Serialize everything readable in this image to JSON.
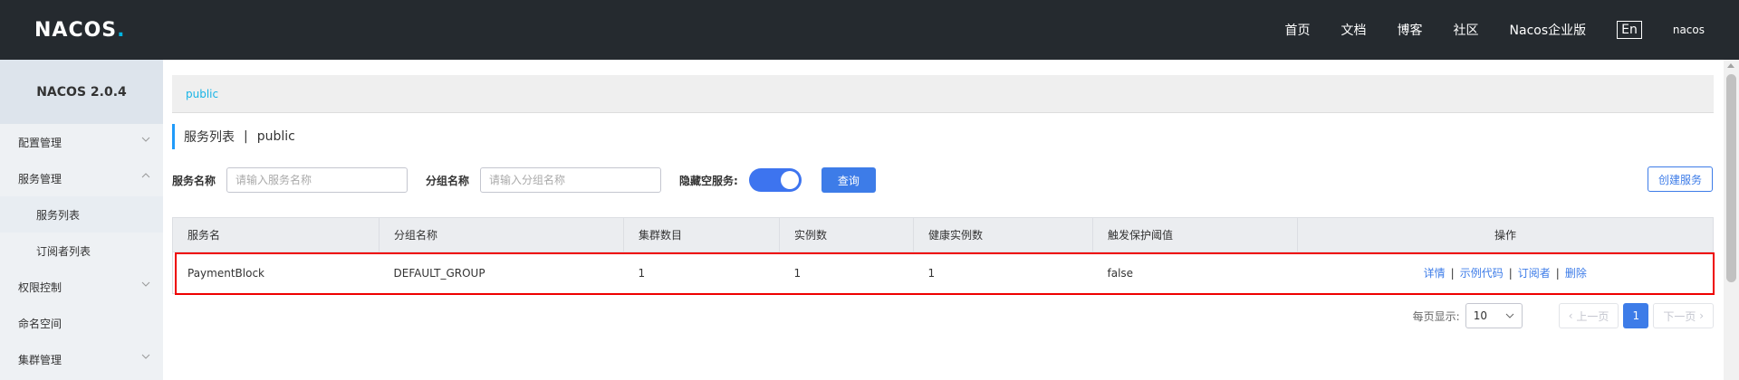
{
  "header": {
    "logo": "NACOS",
    "logo_suffix": ".",
    "nav": [
      "首页",
      "文档",
      "博客",
      "社区",
      "Nacos企业版"
    ],
    "lang": "En",
    "user": "nacos"
  },
  "sidebar": {
    "brand": "NACOS 2.0.4",
    "items": [
      {
        "label": "配置管理"
      },
      {
        "label": "服务管理"
      },
      {
        "label": "服务列表"
      },
      {
        "label": "订阅者列表"
      },
      {
        "label": "权限控制"
      },
      {
        "label": "命名空间"
      },
      {
        "label": "集群管理"
      }
    ]
  },
  "breadcrumb": "public",
  "page_title": {
    "title": "服务列表",
    "sep": "|",
    "namespace": "public"
  },
  "filters": {
    "service_name_label": "服务名称",
    "service_name_placeholder": "请输入服务名称",
    "group_name_label": "分组名称",
    "group_name_placeholder": "请输入分组名称",
    "hide_empty_label": "隐藏空服务:",
    "hide_empty_on": true,
    "query_button": "查询",
    "create_button": "创建服务"
  },
  "table": {
    "columns": [
      "服务名",
      "分组名称",
      "集群数目",
      "实例数",
      "健康实例数",
      "触发保护阈值",
      "操作"
    ],
    "rows": [
      {
        "service": "PaymentBlock",
        "group": "DEFAULT_GROUP",
        "clusters": "1",
        "instances": "1",
        "healthy": "1",
        "threshold": "false",
        "ops": [
          "详情",
          "示例代码",
          "订阅者",
          "删除"
        ],
        "ops_sep": "|"
      }
    ]
  },
  "pagination": {
    "page_size_label": "每页显示:",
    "page_size": "10",
    "prev": "上一页",
    "current": "1",
    "next": "下一页"
  },
  "colors": {
    "header_bg": "#252a2f",
    "primary": "#3d7ce8",
    "highlight": "#e00000"
  }
}
